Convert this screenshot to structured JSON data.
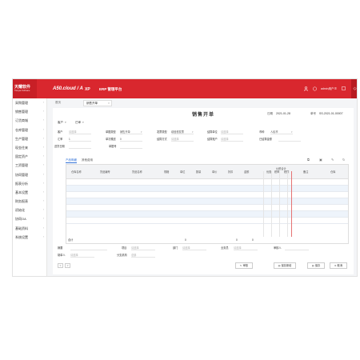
{
  "topbar": {
    "logo_main": "天耀软件",
    "logo_sub": "Tianyao Software",
    "product": "A50.cloud / A",
    "edition": "XP",
    "erp_title": "ERP 管理平台",
    "user_icon": "user-icon",
    "help_icon": "help-icon",
    "user_label": "admin用户",
    "menu_icon": "menu-icon",
    "window_icon": "window-icon",
    "settings_icon": "settings-icon"
  },
  "sidebar": {
    "items": [
      {
        "label": "采购管理"
      },
      {
        "label": "销售管理"
      },
      {
        "label": "订货商城"
      },
      {
        "label": "仓库管理"
      },
      {
        "label": "生产管理"
      },
      {
        "label": "现金往来"
      },
      {
        "label": "固定资产"
      },
      {
        "label": "工资管理"
      },
      {
        "label": "协同管理"
      },
      {
        "label": "报表分析"
      },
      {
        "label": "基本设置"
      },
      {
        "label": "财务报表"
      },
      {
        "label": "初始化"
      },
      {
        "label": "协同OA"
      },
      {
        "label": "基础资料"
      },
      {
        "label": "系统设置"
      }
    ]
  },
  "tabs": {
    "home": "首页",
    "active": "销售开单",
    "close_icon": "close-icon"
  },
  "form": {
    "title": "销售开单",
    "date_label": "日期",
    "date_value": "2021-01-28",
    "docno_label": "单号",
    "docno_value": "SS-2021-01-00007",
    "filter1": "客户",
    "filter2": "已审",
    "row1": [
      {
        "label": "客户",
        "value": "请选择"
      },
      {
        "label": "单据类型",
        "value": "销售开单"
      },
      {
        "label": "发票类型",
        "value": "增值税发票"
      },
      {
        "label": "结算单位",
        "value": "请选择"
      },
      {
        "label": "币种",
        "value": "人民币"
      }
    ],
    "row2": [
      {
        "label": "汇率",
        "value": "1"
      },
      {
        "label": "单次赠送",
        "value": "0"
      },
      {
        "label": "结算方式",
        "value": "请选择"
      },
      {
        "label": "结算账户",
        "value": "请选择"
      },
      {
        "label": "已结算金额",
        "value": ""
      }
    ],
    "row3": [
      {
        "label": "送货日期",
        "value": ""
      },
      {
        "label": "单据号",
        "value": ""
      }
    ]
  },
  "detail": {
    "tab_active": "产品明细",
    "tab_other": "其他费用",
    "tool_icons": [
      "copy-icon",
      "print-icon",
      "edit-icon",
      "refresh-icon"
    ],
    "columns": [
      "仓库名称",
      "货品编号",
      "货品名称",
      "规格",
      "单位",
      "数量",
      "单价",
      "折扣",
      "金额",
      "优惠",
      "税率",
      "税额",
      "价税合计",
      "备注",
      "仓库"
    ],
    "subcolumns": [
      "分",
      "千",
      "百",
      "十",
      "万",
      "千",
      "百",
      "十",
      "元",
      "角",
      "分"
    ],
    "rows": 7,
    "total_label": "合计",
    "total_qty": "0",
    "total_amount1": "0",
    "total_amount2": "0"
  },
  "footer": {
    "row1": [
      {
        "label": "摘要",
        "value": ""
      },
      {
        "label": "项目",
        "value": "请选择"
      },
      {
        "label": "部门",
        "value": "请选择"
      },
      {
        "label": "业务员",
        "value": "请选择"
      },
      {
        "label": "审核人",
        "value": ""
      }
    ],
    "row2": [
      {
        "label": "制单人",
        "value": "请选择"
      },
      {
        "label": "分支机构",
        "value": "总部"
      }
    ]
  },
  "actions": {
    "prev": "<",
    "next": ">",
    "audit": "审核",
    "save_new": "保存新增",
    "save": "保存",
    "cancel": "取消"
  }
}
